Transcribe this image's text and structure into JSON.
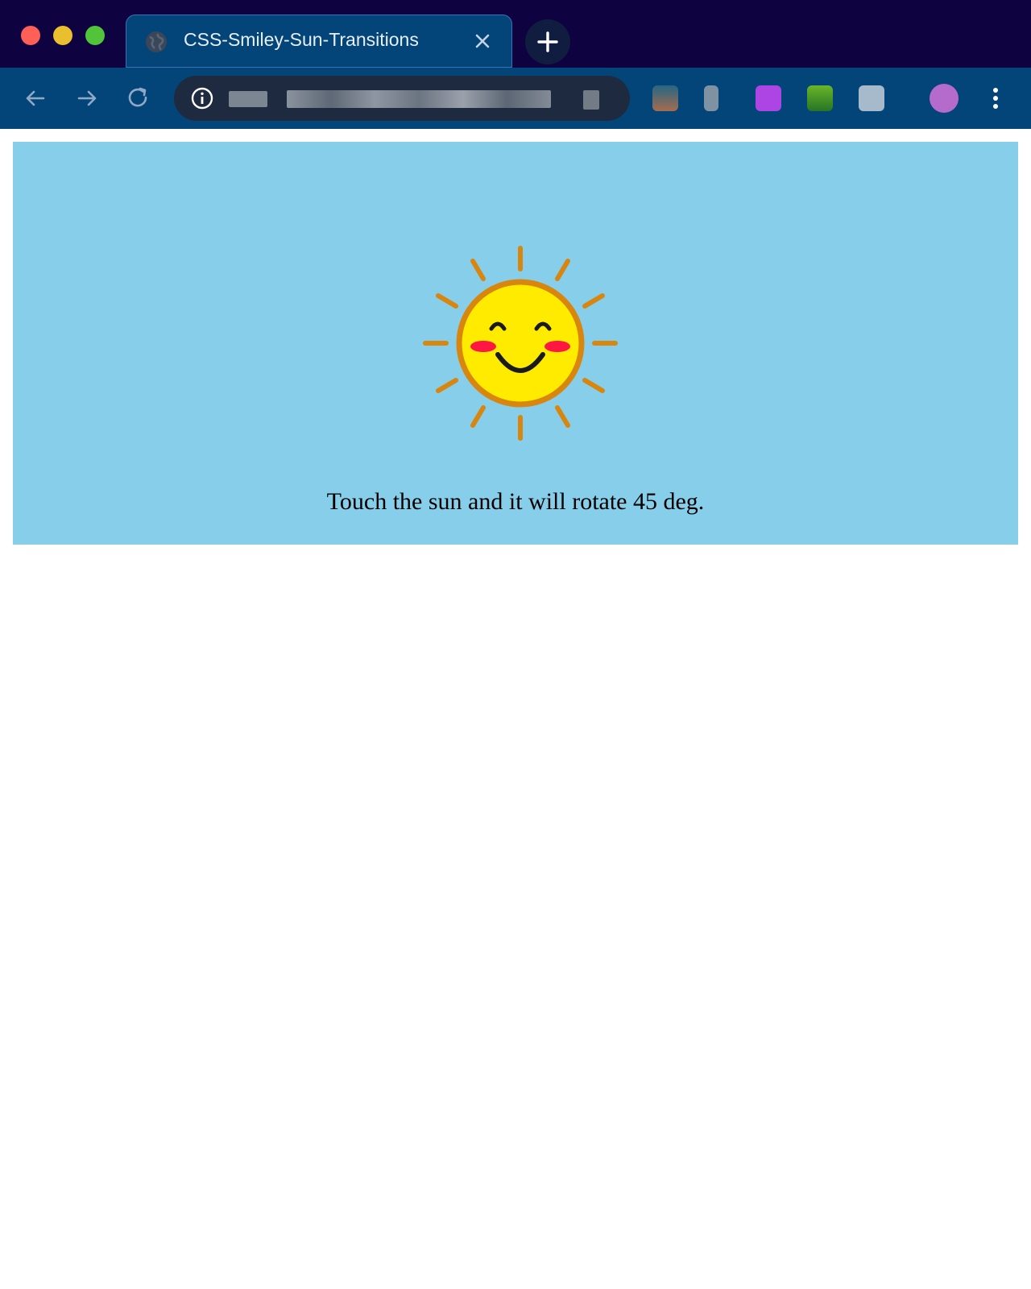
{
  "window": {
    "traffic_lights": {
      "close_color": "#ff5f57",
      "minimize_color": "#febc2e",
      "zoom_color": "#28c840"
    }
  },
  "tab": {
    "title": "CSS-Smiley-Sun-Transitions",
    "favicon": "globe-icon",
    "close_icon": "close-icon"
  },
  "toolbar": {
    "back_icon": "arrow-left-icon",
    "forward_icon": "arrow-right-icon",
    "reload_icon": "reload-icon",
    "info_icon": "info-icon",
    "new_tab_icon": "plus-icon",
    "menu_icon": "kebab-menu-icon"
  },
  "page": {
    "background_color": "#87ceea",
    "caption": "Touch the sun and it will rotate 45 deg.",
    "sun": {
      "face_color": "#ffeb00",
      "ray_color": "#d9860f",
      "cheek_color": "#ff1744"
    }
  }
}
